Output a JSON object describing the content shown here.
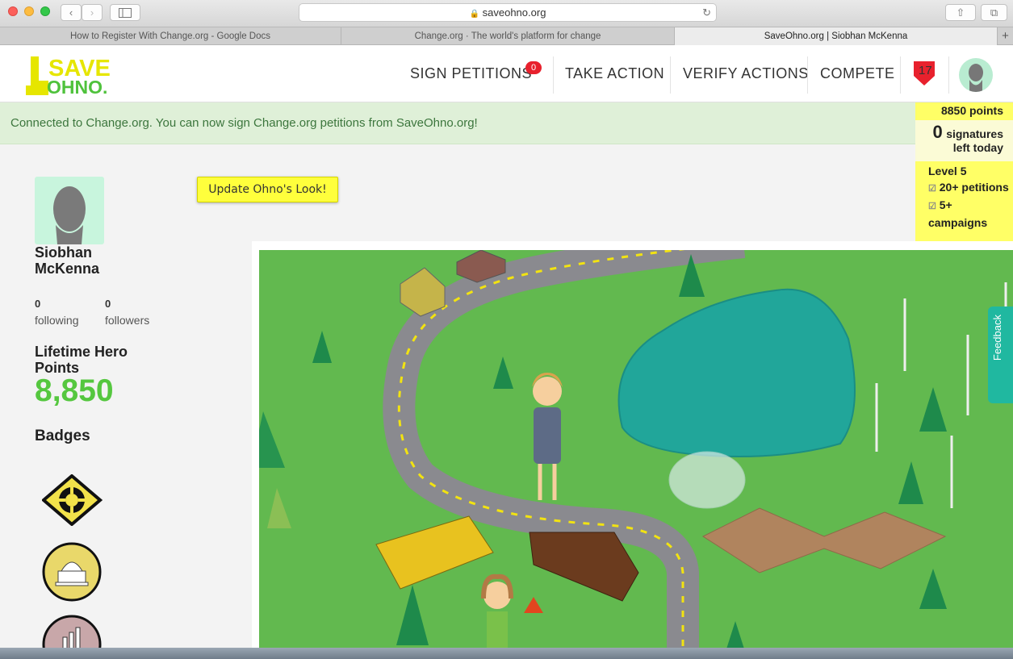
{
  "browser": {
    "url": "saveohno.org",
    "tabs": [
      {
        "label": "How to Register With Change.org - Google Docs"
      },
      {
        "label": "Change.org · The world's platform for change"
      },
      {
        "label": "SaveOhno.org | Siobhan McKenna"
      }
    ]
  },
  "header": {
    "logo_top": "SAVE",
    "logo_bottom": "OHNO.",
    "nav": {
      "sign_petitions": "SIGN PETITIONS",
      "sign_petitions_count": "0",
      "take_action": "TAKE ACTION",
      "verify_actions": "VERIFY ACTIONS",
      "compete": "COMPETE",
      "alert_count": "17"
    }
  },
  "banner": {
    "message": "Connected to Change.org. You can now sign Change.org petitions from SaveOhno.org!"
  },
  "points_panel": {
    "points": "8850 points",
    "signatures_count": "0",
    "signatures_label": "signatures",
    "left_today": "left today",
    "level": "Level 5",
    "req1": "20+ petitions",
    "req2": "5+ campaigns"
  },
  "profile": {
    "name": "Siobhan McKenna",
    "following_count": "0",
    "following_label": "following",
    "followers_count": "0",
    "followers_label": "followers",
    "lifetime_label": "Lifetime Hero Points",
    "lifetime_value": "8,850",
    "badges_title": "Badges"
  },
  "update_button": "Update Ohno's Look!",
  "feedback_label": "Feedback",
  "colors": {
    "brand_yellow": "#e6e600",
    "brand_green": "#55c73f",
    "map_grass": "#62b94f",
    "lake": "#21a69a"
  }
}
